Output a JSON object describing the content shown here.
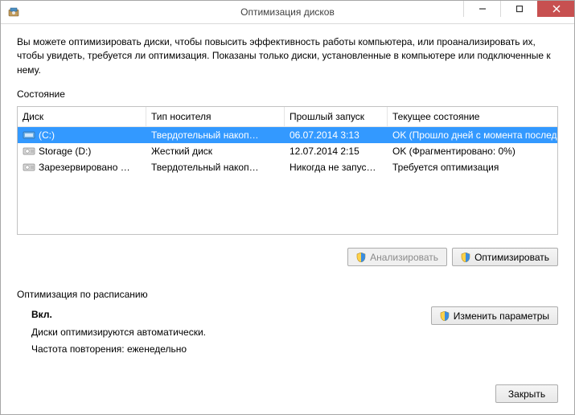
{
  "window": {
    "title": "Оптимизация дисков"
  },
  "intro": "Вы можете оптимизировать диски, чтобы повысить эффективность работы  компьютера, или проанализировать их, чтобы увидеть, требуется ли оптимизация. Показаны только диски, установленные в компьютере или подключенные к нему.",
  "status_label": "Состояние",
  "columns": {
    "disk": "Диск",
    "media": "Тип носителя",
    "last_run": "Прошлый запуск",
    "status": "Текущее состояние"
  },
  "drives": [
    {
      "name": "(C:)",
      "icon": "ssd",
      "media": "Твердотельный накоп…",
      "last_run": "06.07.2014 3:13",
      "status": "OK (Прошло дней с момента последне…",
      "selected": true
    },
    {
      "name": "Storage (D:)",
      "icon": "hdd",
      "media": "Жесткий диск",
      "last_run": "12.07.2014 2:15",
      "status": "OK (Фрагментировано: 0%)",
      "selected": false
    },
    {
      "name": "Зарезервировано …",
      "icon": "hdd",
      "media": "Твердотельный накоп…",
      "last_run": "Никогда не запус…",
      "status": "Требуется оптимизация",
      "selected": false
    }
  ],
  "buttons": {
    "analyze": "Анализировать",
    "optimize": "Оптимизировать",
    "change_settings": "Изменить параметры",
    "close": "Закрыть"
  },
  "schedule": {
    "label": "Оптимизация по расписанию",
    "state": "Вкл.",
    "line1": "Диски оптимизируются автоматически.",
    "line2": "Частота повторения: еженедельно"
  }
}
